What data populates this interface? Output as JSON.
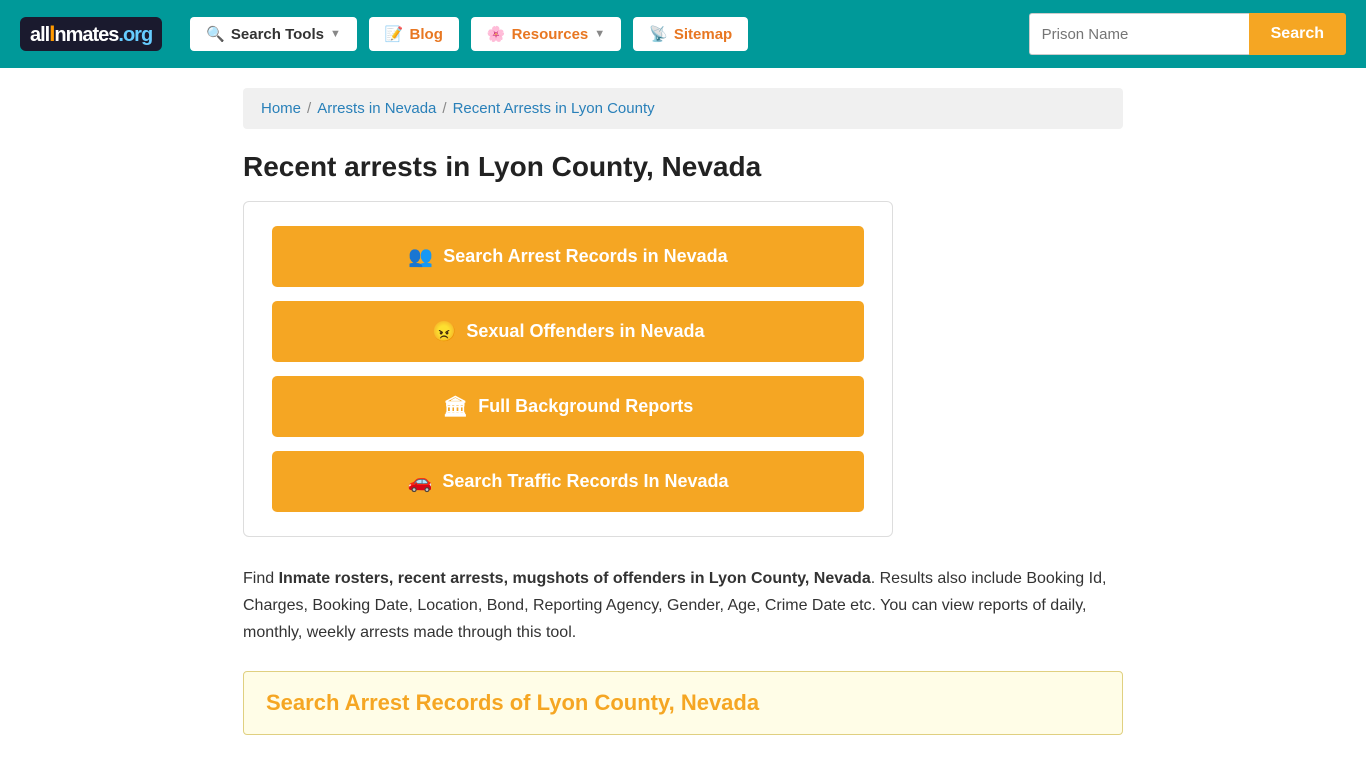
{
  "header": {
    "logo_text": "allInmates.org",
    "nav": [
      {
        "id": "search-tools",
        "label": "Search Tools",
        "has_arrow": true,
        "icon": "🔍"
      },
      {
        "id": "blog",
        "label": "Blog",
        "icon": "📝"
      },
      {
        "id": "resources",
        "label": "Resources",
        "has_arrow": true,
        "icon": "🌸"
      },
      {
        "id": "sitemap",
        "label": "Sitemap",
        "icon": "📡"
      }
    ],
    "search_placeholder": "Prison Name",
    "search_button_label": "Search"
  },
  "breadcrumb": {
    "items": [
      {
        "label": "Home",
        "href": "#"
      },
      {
        "label": "Arrests in Nevada",
        "href": "#"
      },
      {
        "label": "Recent Arrests in Lyon County",
        "href": "#"
      }
    ]
  },
  "page": {
    "title": "Recent arrests in Lyon County, Nevada",
    "buttons": [
      {
        "id": "arrest-records",
        "label": "Search Arrest Records in Nevada",
        "icon": "👥"
      },
      {
        "id": "sexual-offenders",
        "label": "Sexual Offenders in Nevada",
        "icon": "😠"
      },
      {
        "id": "background-reports",
        "label": "Full Background Reports",
        "icon": "🏛"
      },
      {
        "id": "traffic-records",
        "label": "Search Traffic Records In Nevada",
        "icon": "🚗"
      }
    ],
    "description_intro": "Find ",
    "description_bold1": "Inmate rosters, recent arrests, mugshots of offenders in Lyon County, Nevada",
    "description_rest": ". Results also include Booking Id, Charges, Booking Date, Location, Bond, Reporting Agency, Gender, Age, Crime Date etc. You can view reports of daily, monthly, weekly arrests made through this tool.",
    "section_heading": "Search Arrest Records of Lyon County, Nevada"
  }
}
